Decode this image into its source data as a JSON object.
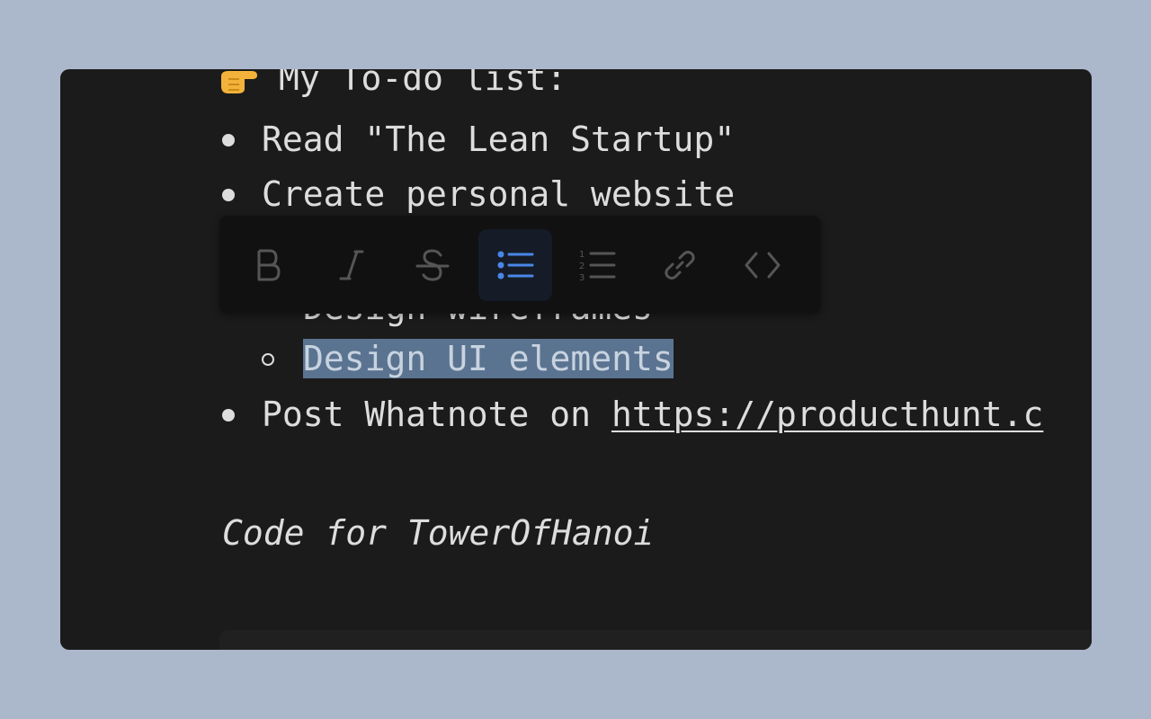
{
  "editor": {
    "heading": "My To-do list:",
    "heading_icon": "pointing-hand-emoji",
    "items": [
      "Read \"The Lean Startup\"",
      "Create personal website"
    ],
    "partial_subitem": "Design wireframes",
    "selected_subitem": "Design UI elements",
    "last_item_prefix": "Post Whatnote on ",
    "last_item_link": "https://producthunt.c",
    "code_title": "Code for TowerOfHanoi"
  },
  "toolbar": {
    "buttons": [
      {
        "name": "bold",
        "icon": "bold-icon",
        "active": false
      },
      {
        "name": "italic",
        "icon": "italic-icon",
        "active": false
      },
      {
        "name": "strikethrough",
        "icon": "strikethrough-icon",
        "active": false
      },
      {
        "name": "bullet-list",
        "icon": "bullet-list-icon",
        "active": true
      },
      {
        "name": "numbered-list",
        "icon": "numbered-list-icon",
        "active": false
      },
      {
        "name": "link",
        "icon": "link-icon",
        "active": false
      },
      {
        "name": "code",
        "icon": "code-icon",
        "active": false
      }
    ]
  },
  "colors": {
    "background": "#abb8cb",
    "editor_bg": "#1b1b1b",
    "text": "#dddddd",
    "selection": "#5a7390",
    "toolbar_bg": "#111111",
    "icon_inactive": "#555555",
    "icon_active": "#4a86e8"
  }
}
